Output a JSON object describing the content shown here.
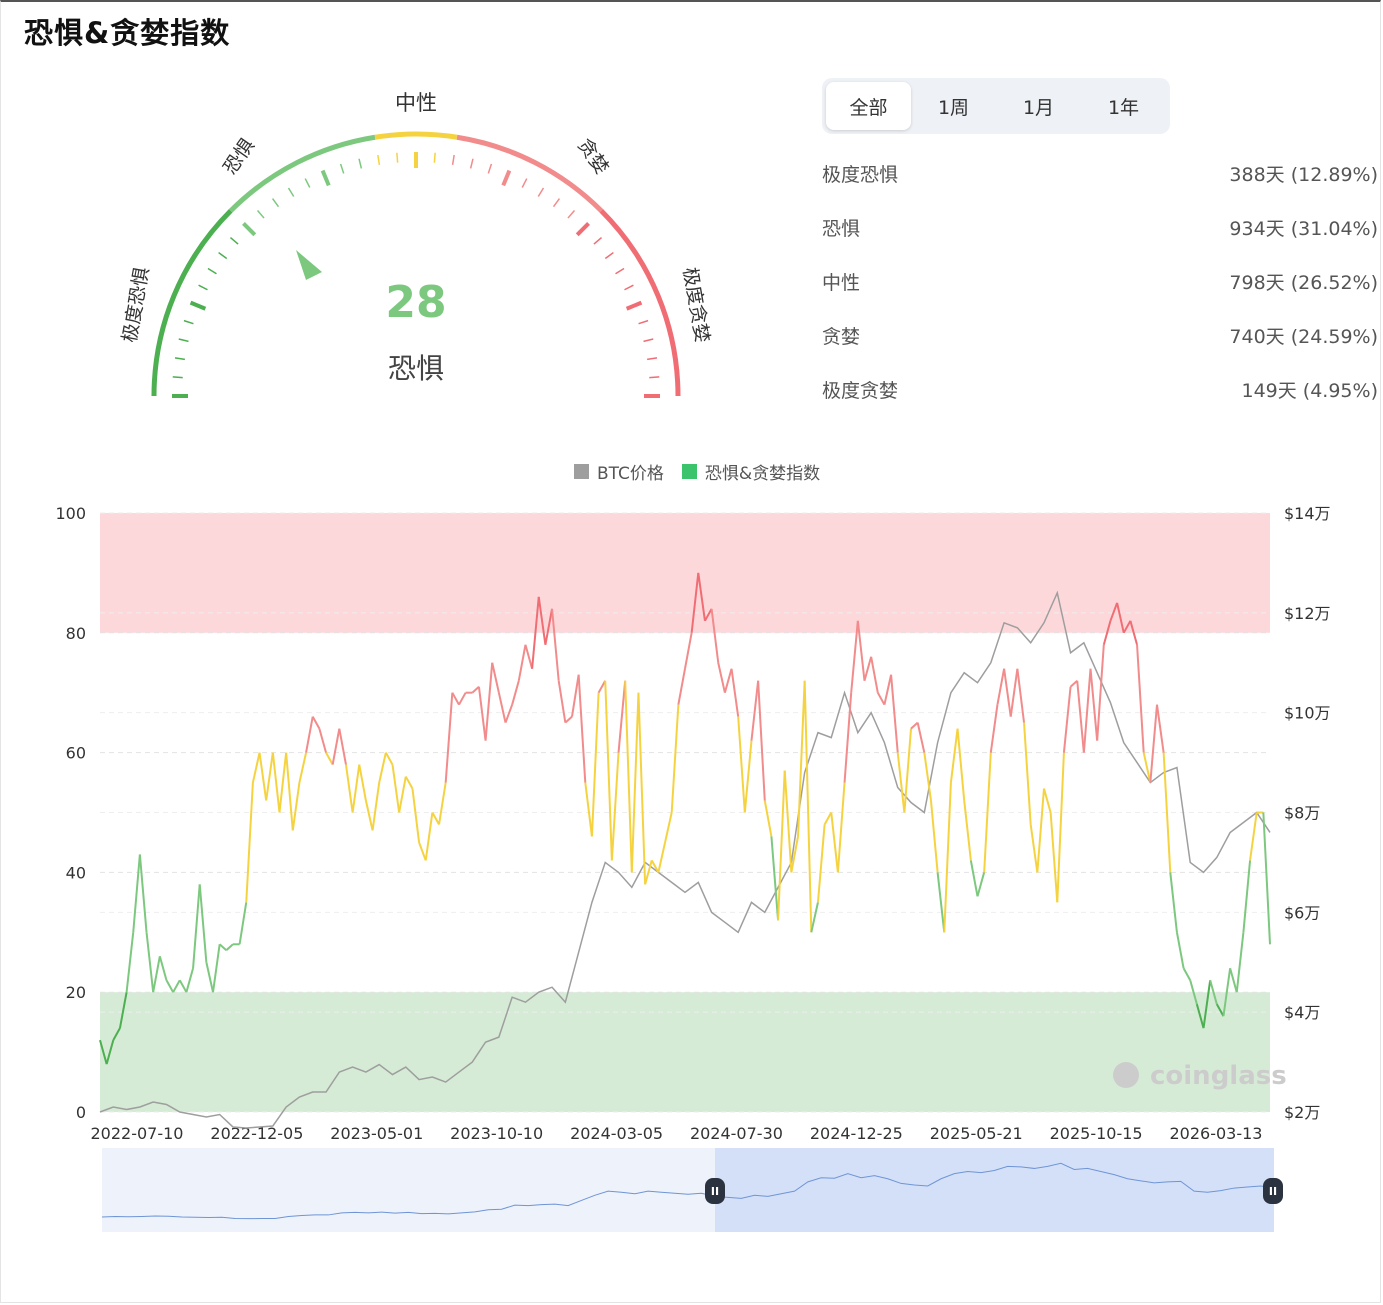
{
  "title": "恐惧&贪婪指数",
  "gauge": {
    "value": "28",
    "status": "恐惧",
    "labels": {
      "extreme_fear": "极度恐惧",
      "fear": "恐惧",
      "neutral": "中性",
      "greed": "贪婪",
      "extreme_greed": "极度贪婪"
    }
  },
  "tabs": [
    {
      "label": "全部",
      "active": true
    },
    {
      "label": "1周",
      "active": false
    },
    {
      "label": "1月",
      "active": false
    },
    {
      "label": "1年",
      "active": false
    }
  ],
  "stats": [
    {
      "label": "极度恐惧",
      "value": "388天 (12.89%)"
    },
    {
      "label": "恐惧",
      "value": "934天 (31.04%)"
    },
    {
      "label": "中性",
      "value": "798天 (26.52%)"
    },
    {
      "label": "贪婪",
      "value": "740天 (24.59%)"
    },
    {
      "label": "极度贪婪",
      "value": "149天 (4.95%)"
    }
  ],
  "legend": {
    "btc": "BTC价格",
    "fgi": "恐惧&贪婪指数"
  },
  "watermark": "coinglass",
  "colors": {
    "extreme_fear": "#4caf50",
    "fear": "#7dc87f",
    "neutral": "#f5d340",
    "greed": "#f28b8b",
    "extreme_greed": "#f06d74",
    "btc_line": "#9e9e9e",
    "legend_fgi": "#3cc46d",
    "legend_btc": "#9e9e9e"
  },
  "chart_data": {
    "type": "line",
    "x_ticks": [
      "2022-07-10",
      "2022-12-05",
      "2023-05-01",
      "2023-10-10",
      "2024-03-05",
      "2024-07-30",
      "2024-12-25",
      "2025-05-21",
      "2025-10-15",
      "2026-03-13"
    ],
    "y_left_ticks": [
      "0",
      "20",
      "40",
      "60",
      "80",
      "100"
    ],
    "y_left_lim": [
      0,
      100
    ],
    "y_right_ticks": [
      "$2万",
      "$4万",
      "$6万",
      "$8万",
      "$10万",
      "$12万",
      "$14万"
    ],
    "y_right_lim": [
      20000,
      140000
    ],
    "bands": [
      {
        "from": 0,
        "to": 20,
        "color": "#d5ebd6"
      },
      {
        "from": 80,
        "to": 100,
        "color": "#fdd8db"
      }
    ],
    "thresholds": [
      20,
      40,
      60,
      80
    ],
    "series": [
      {
        "name": "恐惧&贪婪指数",
        "values": [
          12,
          8,
          12,
          14,
          20,
          30,
          43,
          30,
          20,
          26,
          22,
          20,
          22,
          20,
          24,
          38,
          25,
          20,
          28,
          27,
          28,
          28,
          35,
          55,
          60,
          52,
          60,
          50,
          60,
          47,
          55,
          60,
          66,
          64,
          60,
          58,
          64,
          58,
          50,
          58,
          52,
          47,
          55,
          60,
          58,
          50,
          56,
          54,
          45,
          42,
          50,
          48,
          55,
          70,
          68,
          70,
          70,
          71,
          62,
          75,
          70,
          65,
          68,
          72,
          78,
          74,
          86,
          78,
          84,
          72,
          65,
          66,
          73,
          55,
          46,
          70,
          72,
          42,
          60,
          72,
          40,
          70,
          38,
          42,
          40,
          45,
          50,
          68,
          74,
          80,
          90,
          82,
          84,
          75,
          70,
          74,
          66,
          50,
          62,
          72,
          52,
          46,
          32,
          57,
          40,
          46,
          72,
          30,
          35,
          48,
          50,
          40,
          55,
          70,
          82,
          72,
          76,
          70,
          68,
          73,
          60,
          50,
          64,
          65,
          60,
          52,
          40,
          30,
          55,
          64,
          52,
          42,
          36,
          40,
          60,
          68,
          74,
          66,
          74,
          65,
          48,
          40,
          54,
          50,
          35,
          60,
          71,
          72,
          60,
          74,
          62,
          78,
          82,
          85,
          80,
          82,
          78,
          60,
          55,
          68,
          60,
          40,
          30,
          24,
          22,
          18,
          14,
          22,
          18,
          16,
          24,
          20,
          30,
          42,
          50,
          50,
          28
        ]
      },
      {
        "name": "BTC价格",
        "values": [
          20000,
          21000,
          20500,
          21000,
          22000,
          21500,
          20000,
          19500,
          19000,
          19500,
          17000,
          16800,
          17000,
          17200,
          21000,
          23000,
          24000,
          24000,
          28000,
          29000,
          28000,
          29500,
          27500,
          29000,
          26500,
          27000,
          26000,
          28000,
          30000,
          34000,
          35000,
          43000,
          42000,
          44000,
          45000,
          42000,
          52000,
          62000,
          70000,
          68000,
          65000,
          70000,
          68000,
          66000,
          64000,
          66000,
          60000,
          58000,
          56000,
          62000,
          60000,
          65000,
          70000,
          88000,
          96000,
          95000,
          104000,
          96000,
          100000,
          94000,
          85000,
          82000,
          80000,
          94000,
          104000,
          108000,
          106000,
          110000,
          118000,
          117000,
          114000,
          118000,
          124000,
          112000,
          114000,
          108000,
          102000,
          94000,
          90000,
          86000,
          88000,
          89000,
          70000,
          68000,
          71000,
          76000,
          78000,
          80000,
          76000
        ]
      }
    ]
  },
  "navigator": {
    "handle_start": "II",
    "handle_end": "II"
  }
}
